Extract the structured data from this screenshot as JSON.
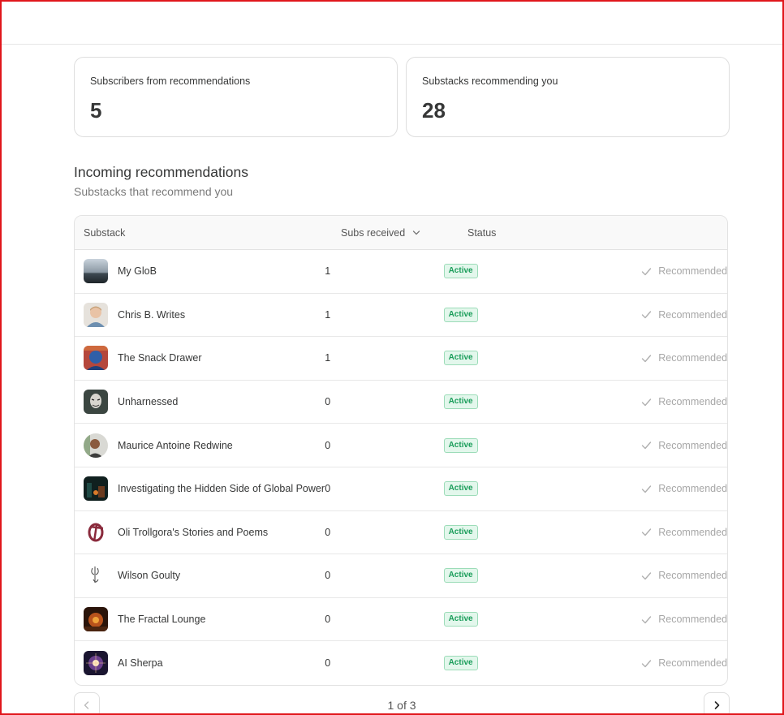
{
  "stats": [
    {
      "label": "Subscribers from recommendations",
      "value": "5"
    },
    {
      "label": "Substacks recommending you",
      "value": "28"
    }
  ],
  "section": {
    "title": "Incoming recommendations",
    "subtitle": "Substacks that recommend you"
  },
  "table": {
    "columns": {
      "substack": "Substack",
      "subs": "Subs received",
      "status": "Status"
    },
    "rows": [
      {
        "name": "My GloB",
        "subs": "1",
        "status": "Active",
        "rec": "Recommended"
      },
      {
        "name": "Chris B. Writes",
        "subs": "1",
        "status": "Active",
        "rec": "Recommended"
      },
      {
        "name": "The Snack Drawer",
        "subs": "1",
        "status": "Active",
        "rec": "Recommended"
      },
      {
        "name": "Unharnessed",
        "subs": "0",
        "status": "Active",
        "rec": "Recommended"
      },
      {
        "name": "Maurice Antoine Redwine",
        "subs": "0",
        "status": "Active",
        "rec": "Recommended"
      },
      {
        "name": "Investigating the Hidden Side of Global Power",
        "subs": "0",
        "status": "Active",
        "rec": "Recommended"
      },
      {
        "name": "Oli Trollgora's Stories and Poems",
        "subs": "0",
        "status": "Active",
        "rec": "Recommended"
      },
      {
        "name": "Wilson Goulty",
        "subs": "0",
        "status": "Active",
        "rec": "Recommended"
      },
      {
        "name": "The Fractal Lounge",
        "subs": "0",
        "status": "Active",
        "rec": "Recommended"
      },
      {
        "name": "AI Sherpa",
        "subs": "0",
        "status": "Active",
        "rec": "Recommended"
      }
    ]
  },
  "pagination": {
    "text": "1 of 3"
  },
  "colors": {
    "accent_border": "#e0161b",
    "active_green": "#1a9d5a",
    "active_bg": "#e3f7ec"
  }
}
